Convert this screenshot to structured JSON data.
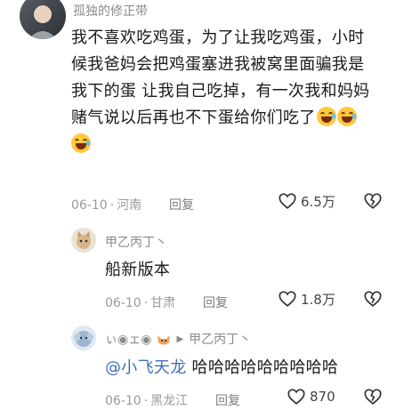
{
  "comment": {
    "username": "孤独的修正带",
    "lines": [
      "我不喜欢吃鸡蛋，为了让我吃鸡蛋，小时",
      "候我爸妈会把鸡蛋塞进我被窝里面骗我是",
      "我下的蛋 让我自己吃掉，有一次我和妈妈",
      "赌气说以后再也不下蛋给你们吃了"
    ],
    "date": "06-10",
    "location": "河南",
    "reply_label": "回复",
    "likes": "6.5万"
  },
  "replies": [
    {
      "username": "甲乙丙丁丶",
      "text": "船新版本",
      "date": "06-10",
      "location": "甘肃",
      "reply_label": "回复",
      "likes": "1.8万"
    },
    {
      "username": "ぃ◉ェ◉",
      "reply_to": "甲乙丙丁丶",
      "mention": "@小飞天龙",
      "text": " 哈哈哈哈哈哈哈哈哈",
      "date": "06-10",
      "location": "黑龙江",
      "reply_label": "回复",
      "likes": "870"
    }
  ],
  "icons": {
    "like": "heart-outline-icon",
    "dislike": "broken-heart-icon",
    "emoji": "grinning-sweat-emoji"
  },
  "colors": {
    "username": "#8a8a8a",
    "mention": "#3f6fb5",
    "meta": "#9a9a9a"
  }
}
